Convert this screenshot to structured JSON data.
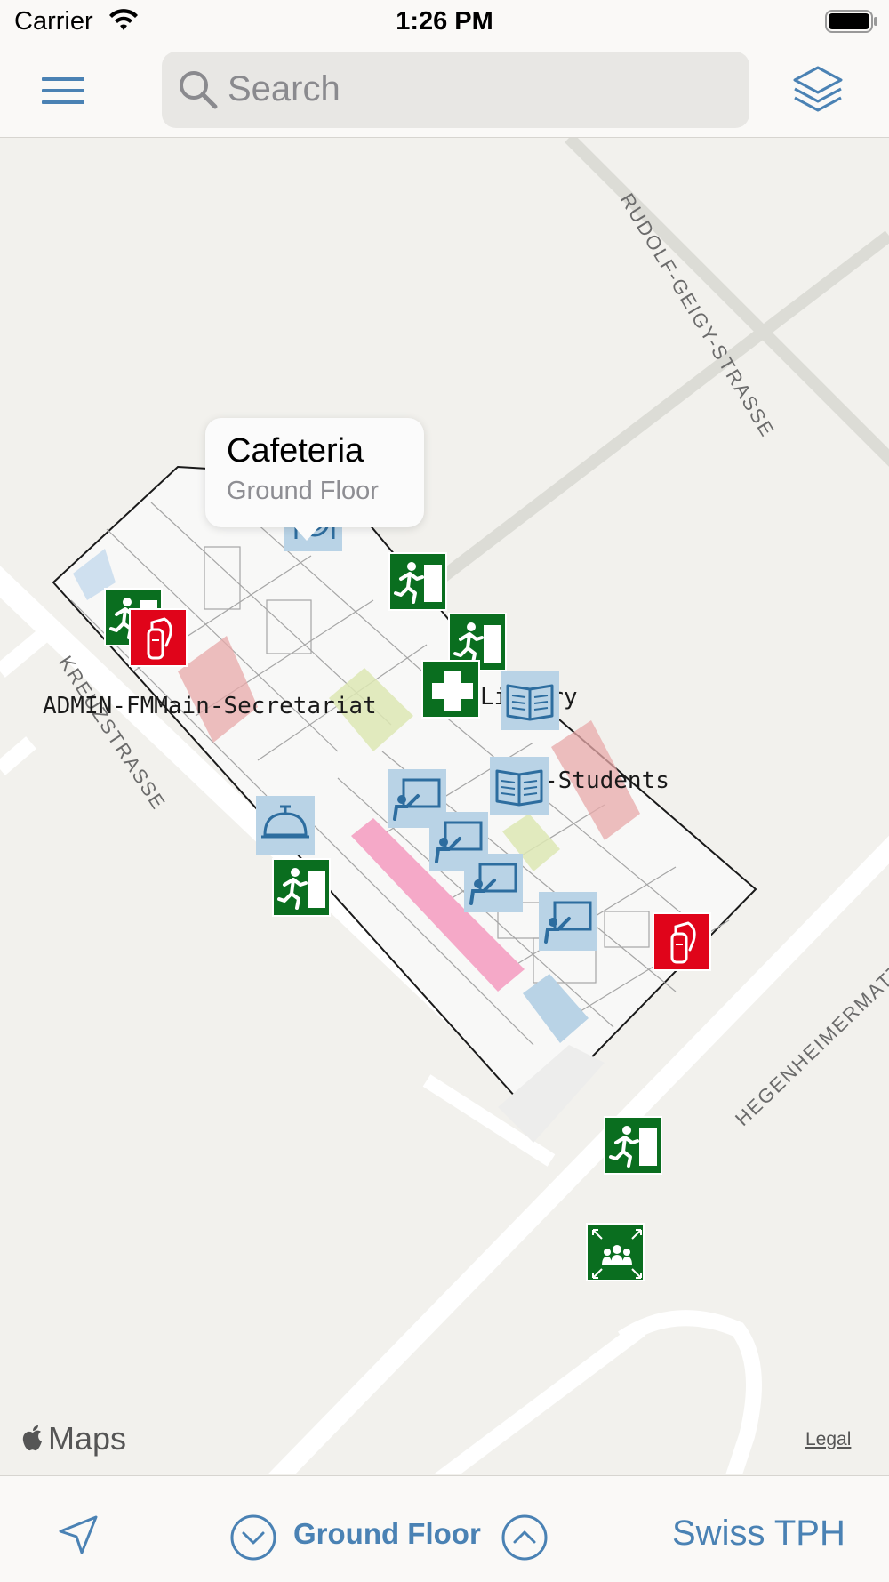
{
  "status_bar": {
    "carrier": "Carrier",
    "time": "1:26 PM"
  },
  "search": {
    "placeholder": "Search"
  },
  "map": {
    "streets": [
      "RUDOLF-GEIGY-STRASSE",
      "KREUZSTRASSE",
      "HEGENHEIMERMATT"
    ],
    "labels": {
      "admin": "ADMIN-FMMain-Secretariat",
      "library": "Library",
      "students": "-Students"
    },
    "callout": {
      "title": "Cafeteria",
      "subtitle": "Ground Floor"
    },
    "attribution": "Maps",
    "legal": "Legal"
  },
  "bottom_bar": {
    "floor": "Ground Floor",
    "organization": "Swiss TPH"
  },
  "colors": {
    "accent": "#4a82b4",
    "exit_green": "#0a6e1f",
    "fire_red": "#e0041a",
    "poi_blue": "#b9d3e6"
  },
  "icons": [
    "menu-icon",
    "search-icon",
    "layers-icon",
    "location-arrow-icon",
    "chevron-down-circle-icon",
    "chevron-up-circle-icon",
    "apple-logo-icon"
  ]
}
